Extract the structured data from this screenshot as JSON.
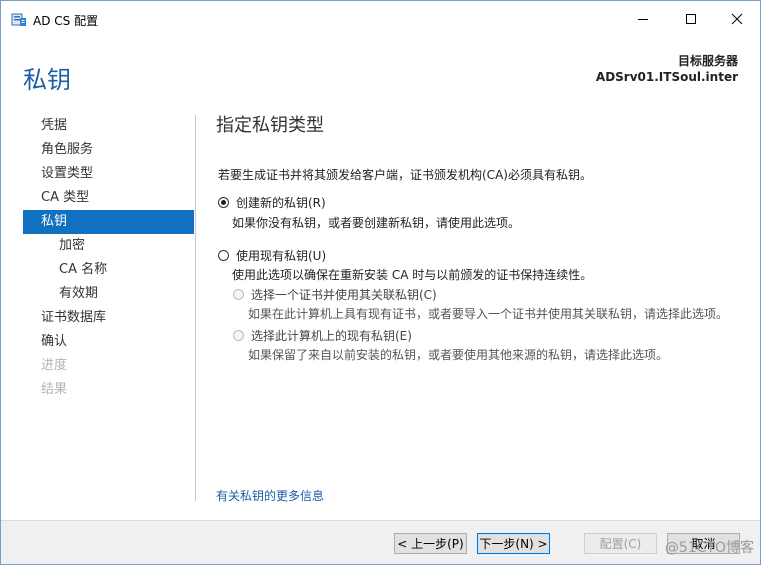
{
  "window": {
    "title": "AD CS 配置"
  },
  "header": {
    "title": "私钥",
    "target_label": "目标服务器",
    "target_value": "ADSrv01.ITSoul.inter"
  },
  "nav": {
    "items": [
      {
        "label": "凭据",
        "state": "normal",
        "level": 0
      },
      {
        "label": "角色服务",
        "state": "normal",
        "level": 0
      },
      {
        "label": "设置类型",
        "state": "normal",
        "level": 0
      },
      {
        "label": "CA 类型",
        "state": "normal",
        "level": 0
      },
      {
        "label": "私钥",
        "state": "selected",
        "level": 0
      },
      {
        "label": "加密",
        "state": "normal",
        "level": 1
      },
      {
        "label": "CA 名称",
        "state": "normal",
        "level": 1
      },
      {
        "label": "有效期",
        "state": "normal",
        "level": 1
      },
      {
        "label": "证书数据库",
        "state": "normal",
        "level": 0
      },
      {
        "label": "确认",
        "state": "normal",
        "level": 0
      },
      {
        "label": "进度",
        "state": "disabled",
        "level": 0
      },
      {
        "label": "结果",
        "state": "disabled",
        "level": 0
      }
    ]
  },
  "main": {
    "title": "指定私钥类型",
    "description": "若要生成证书并将其颁发给客户端，证书颁发机构(CA)必须具有私钥。",
    "option_new": {
      "label": "创建新的私钥(R)",
      "desc": "如果你没有私钥，或者要创建新私钥，请使用此选项。",
      "checked": true
    },
    "option_existing": {
      "label": "使用现有私钥(U)",
      "desc": "使用此选项以确保在重新安装 CA 时与以前颁发的证书保持连续性。",
      "checked": false,
      "sub_cert": {
        "label": "选择一个证书并使用其关联私钥(C)",
        "desc": "如果在此计算机上具有现有证书，或者要导入一个证书并使用其关联私钥，请选择此选项。"
      },
      "sub_key": {
        "label": "选择此计算机上的现有私钥(E)",
        "desc": "如果保留了来自以前安装的私钥，或者要使用其他来源的私钥，请选择此选项。"
      }
    },
    "more_link": "有关私钥的更多信息"
  },
  "footer": {
    "prev": "< 上一步(P)",
    "next": "下一步(N) >",
    "configure": "配置(C)",
    "cancel": "取消"
  },
  "watermark": "@51CTO博客"
}
